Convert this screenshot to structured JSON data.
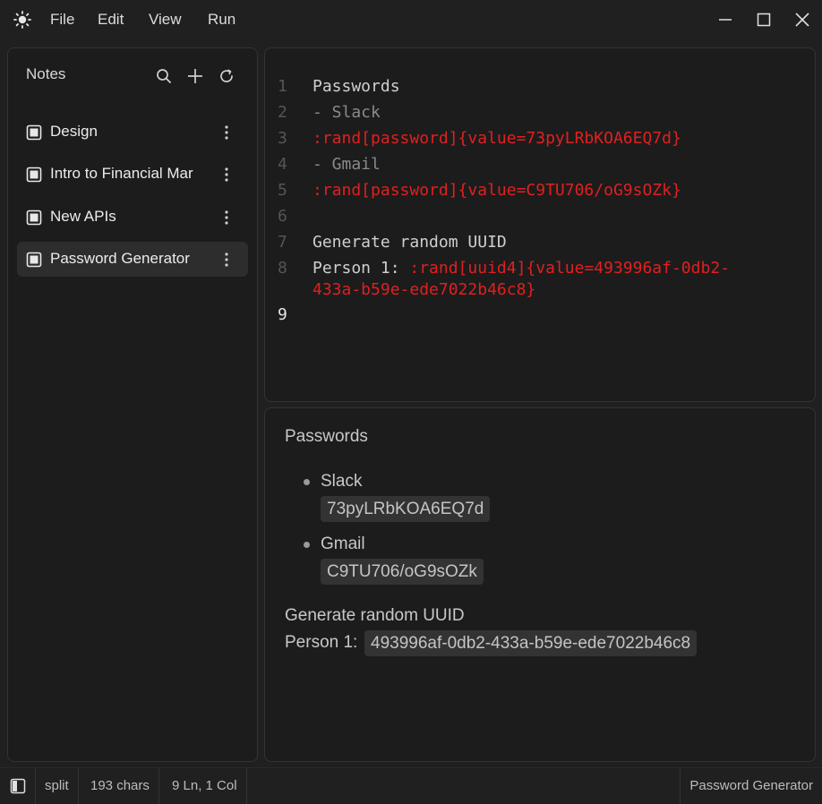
{
  "menu": {
    "file": "File",
    "edit": "Edit",
    "view": "View",
    "run": "Run"
  },
  "sidebar": {
    "title": "Notes",
    "notes": [
      {
        "label": "Design"
      },
      {
        "label": "Intro to Financial Mar"
      },
      {
        "label": "New APIs"
      },
      {
        "label": "Password Generator",
        "active": true
      }
    ]
  },
  "editor": {
    "line_numbers": [
      "1",
      "2",
      "3",
      "4",
      "5",
      "6",
      "7",
      "8",
      "9"
    ],
    "lines": {
      "l1": "Passwords",
      "l2": "- Slack",
      "l3": ":rand[password]{value=73pyLRbKOA6EQ7d}",
      "l4": "- Gmail",
      "l5": ":rand[password]{value=C9TU706/oG9sOZk}",
      "l7": "Generate random UUID",
      "l8_prefix": "Person 1: ",
      "l8_directive_a": ":rand[uuid4]{value=493996af-0db2-",
      "l8_directive_b": "433a-b59e-ede7022b46c8}"
    }
  },
  "preview": {
    "heading": "Passwords",
    "items": [
      {
        "label": "Slack",
        "value": "73pyLRbKOA6EQ7d"
      },
      {
        "label": "Gmail",
        "value": "C9TU706/oG9sOZk"
      }
    ],
    "uuid_heading": "Generate random UUID",
    "person_label": "Person 1:",
    "person_value": "493996af-0db2-433a-b59e-ede7022b46c8"
  },
  "status": {
    "mode": "split",
    "chars": "193 chars",
    "position": "9 Ln, 1 Col",
    "note_name": "Password Generator"
  },
  "colors": {
    "accent_red": "#e02020",
    "background": "#202020",
    "panel": "#1c1c1c"
  }
}
